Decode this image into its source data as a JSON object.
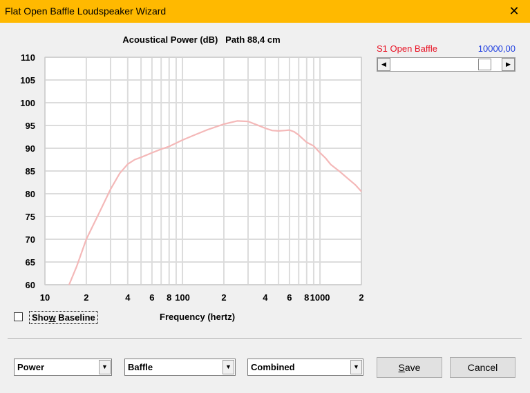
{
  "window": {
    "title": "Flat Open Baffle Loudspeaker Wizard",
    "close_glyph": "✕"
  },
  "chart_title": "Acoustical Power (dB)   Path 88,4 cm",
  "x_axis_label": "Frequency (hertz)",
  "series_panel": {
    "label": "S1  Open Baffle",
    "value": "10000,00",
    "scroll_left_glyph": "◀",
    "scroll_right_glyph": "▶",
    "slider_position": 0.88
  },
  "show_baseline": {
    "label": "Show Baseline",
    "underlined_char": "w",
    "checked": false
  },
  "dropdowns": [
    {
      "value": "Power"
    },
    {
      "value": "Baffle"
    },
    {
      "value": "Combined"
    }
  ],
  "dropdown_arrow_glyph": "▼",
  "buttons": {
    "save": "Save",
    "save_access_key": "S",
    "save_rest": "ave",
    "cancel": "Cancel"
  },
  "chart_data": {
    "type": "line",
    "xscale": "log",
    "xlim": [
      10,
      2000
    ],
    "ylim": [
      60,
      110
    ],
    "grid": true,
    "title": "Acoustical Power (dB)   Path 88,4 cm",
    "xlabel": "Frequency (hertz)",
    "ylabel": "",
    "yticks": [
      60,
      65,
      70,
      75,
      80,
      85,
      90,
      95,
      100,
      105,
      110
    ],
    "xtick_labels": [
      {
        "x": 10,
        "label": "10"
      },
      {
        "x": 20,
        "label": "2"
      },
      {
        "x": 40,
        "label": "4"
      },
      {
        "x": 60,
        "label": "6"
      },
      {
        "x": 80,
        "label": "8"
      },
      {
        "x": 100,
        "label": "100"
      },
      {
        "x": 200,
        "label": "2"
      },
      {
        "x": 400,
        "label": "4"
      },
      {
        "x": 600,
        "label": "6"
      },
      {
        "x": 800,
        "label": "8"
      },
      {
        "x": 1000,
        "label": "1000"
      },
      {
        "x": 2000,
        "label": "2"
      }
    ],
    "color": "#f4b8b8",
    "series": [
      {
        "x": [
          15,
          17,
          20,
          25,
          30,
          35,
          40,
          45,
          50,
          60,
          70,
          80,
          100,
          120,
          150,
          200,
          250,
          300,
          350,
          400,
          450,
          500,
          550,
          600,
          650,
          700,
          800,
          900,
          1000,
          1100,
          1200,
          1400,
          1600,
          1800,
          2000
        ],
        "y": [
          60,
          64,
          70,
          76,
          81,
          84.5,
          86.5,
          87.5,
          88,
          89,
          89.8,
          90.4,
          91.8,
          92.8,
          94,
          95.3,
          96.0,
          95.9,
          95.1,
          94.4,
          93.9,
          93.8,
          93.9,
          94.0,
          93.6,
          92.9,
          91.3,
          90.5,
          89.0,
          87.8,
          86.4,
          84.8,
          83.3,
          82.0,
          80.5
        ]
      }
    ]
  }
}
